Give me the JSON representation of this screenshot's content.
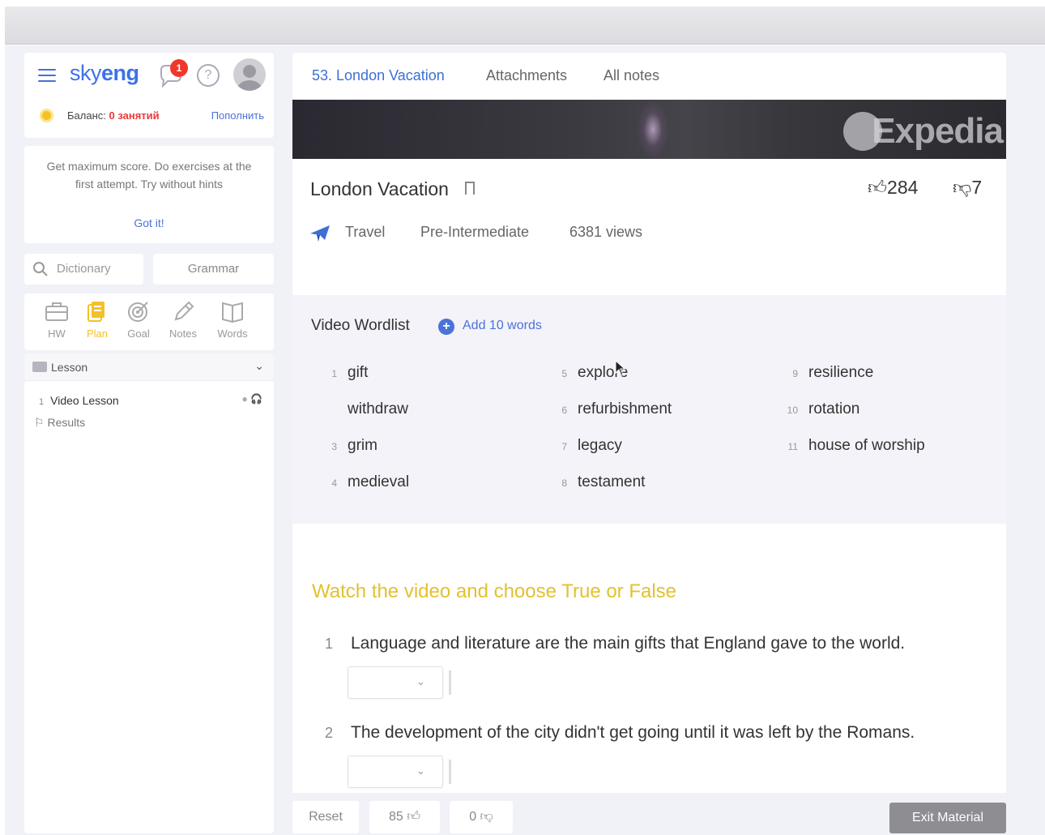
{
  "sidebar": {
    "brand": {
      "logo_regular": "sky",
      "logo_bold": "eng",
      "notification_count": "1",
      "help_symbol": "?"
    },
    "balance": {
      "label": "Баланс: ",
      "value": "0 занятий",
      "topup_label": "Пополнить"
    },
    "tip": {
      "text": "Get maximum score. Do exercises at the first attempt. Try without hints",
      "dismiss_label": "Got it!"
    },
    "search": {
      "dictionary_label": "Dictionary",
      "grammar_label": "Grammar"
    },
    "tools": [
      {
        "label": "HW",
        "icon": "briefcase-icon"
      },
      {
        "label": "Plan",
        "icon": "plan-icon",
        "active": true
      },
      {
        "label": "Goal",
        "icon": "target-icon"
      },
      {
        "label": "Notes",
        "icon": "pencil-icon"
      },
      {
        "label": "Words",
        "icon": "book-icon"
      }
    ],
    "section_label": "Lesson",
    "items": [
      {
        "number": "1",
        "label": "Video Lesson",
        "icons": "● 🎧"
      },
      {
        "label": "Results"
      }
    ]
  },
  "header": {
    "tabs": [
      {
        "label": "53. London Vacation",
        "active": true
      },
      {
        "label": "Attachments"
      },
      {
        "label": "All notes"
      }
    ]
  },
  "banner": {
    "watermark": "Expedia"
  },
  "lesson": {
    "title": "London Vacation",
    "likes": "284",
    "dislikes": "7",
    "category": "Travel",
    "level": "Pre-Intermediate",
    "views": "6381 views"
  },
  "wordlist": {
    "title": "Video Wordlist",
    "add_label": "Add 10 words",
    "words": [
      {
        "n": "1",
        "w": "gift"
      },
      {
        "n": "",
        "w": "withdraw"
      },
      {
        "n": "3",
        "w": "grim"
      },
      {
        "n": "4",
        "w": "medieval"
      },
      {
        "n": "5",
        "w": "explore"
      },
      {
        "n": "6",
        "w": "refurbishment"
      },
      {
        "n": "7",
        "w": "legacy"
      },
      {
        "n": "8",
        "w": "testament"
      },
      {
        "n": "9",
        "w": "resilience"
      },
      {
        "n": "10",
        "w": "rotation"
      },
      {
        "n": "11",
        "w": "house of worship"
      }
    ]
  },
  "exercise": {
    "title": "Watch the video and choose True or False",
    "questions": [
      {
        "n": "1",
        "text": "Language and literature are the main gifts that England gave to the world."
      },
      {
        "n": "2",
        "text": "The development of the city didn't get going until it was left by the Romans."
      }
    ]
  },
  "footer": {
    "reset_label": "Reset",
    "likes_count": "85",
    "dislikes_count": "0",
    "exit_label": "Exit Material"
  },
  "colors": {
    "accent_blue": "#3d72e6",
    "exercise_title": "#e3c12f",
    "badge_red": "#f0372b",
    "exit_button": "#8d8d92"
  }
}
